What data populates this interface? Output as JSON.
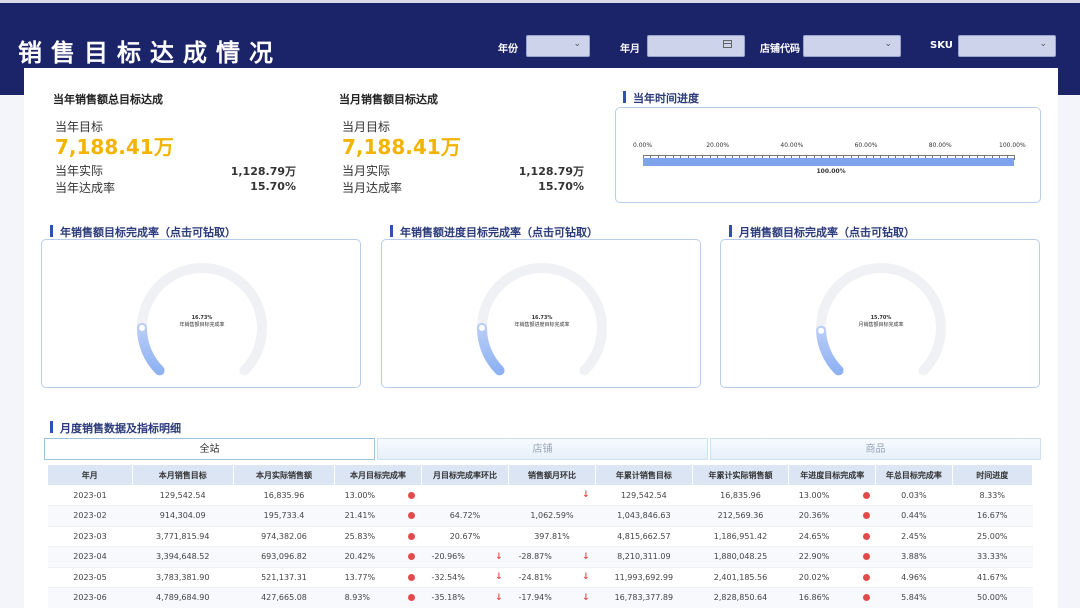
{
  "header": {
    "title": "销售目标达成情况",
    "filters": [
      {
        "label": "年份",
        "type": "select"
      },
      {
        "label": "年月",
        "type": "date"
      },
      {
        "label": "店铺代码",
        "type": "select"
      },
      {
        "label": "SKU",
        "type": "select"
      }
    ]
  },
  "kpi_year": {
    "title": "当年销售额总目标达成",
    "target_label": "当年目标",
    "target_value": "7,188.41万",
    "actual_label": "当年实际",
    "actual_value": "1,128.79万",
    "rate_label": "当年达成率",
    "rate_value": "15.70%"
  },
  "kpi_month": {
    "title": "当月销售额目标达成",
    "target_label": "当月目标",
    "target_value": "7,188.41万",
    "actual_label": "当月实际",
    "actual_value": "1,128.79万",
    "rate_label": "当月达成率",
    "rate_value": "15.70%"
  },
  "time_progress": {
    "title": "当年时间进度",
    "ticks": [
      "0.00%",
      "20.00%",
      "40.00%",
      "60.00%",
      "80.00%",
      "100.00%"
    ],
    "value": 1.0,
    "value_label": "100.00%"
  },
  "gauges": [
    {
      "title": "年销售额目标完成率（点击可钻取）",
      "value_label": "16.73%",
      "caption": "年销售额目标完成率",
      "value": 0.1673
    },
    {
      "title": "年销售额进度目标完成率（点击可钻取）",
      "value_label": "16.73%",
      "caption": "年销售额进度目标完成率",
      "value": 0.1673
    },
    {
      "title": "月销售额目标完成率（点击可钻取）",
      "value_label": "15.70%",
      "caption": "月销售额目标完成率",
      "value": 0.157
    }
  ],
  "detail": {
    "title": "月度销售数据及指标明细",
    "tabs": [
      "全站",
      "店铺",
      "商品"
    ],
    "columns": [
      "年月",
      "本月销售目标",
      "本月实际销售额",
      "本月目标完成率",
      "月目标完成率环比",
      "销售额月环比",
      "年累计销售目标",
      "年累计实际销售额",
      "年进度目标完成率",
      "年总目标完成率",
      "时间进度"
    ],
    "rows": [
      [
        "2023-01",
        "129,542.54",
        "16,835.96",
        "13.00%",
        "",
        "",
        "129,542.54",
        "16,835.96",
        "13.00%",
        "0.03%",
        "8.33%"
      ],
      [
        "2023-02",
        "914,304.09",
        "195,733.4",
        "21.41%",
        "64.72%",
        "1,062.59%",
        "1,043,846.63",
        "212,569.36",
        "20.36%",
        "0.44%",
        "16.67%"
      ],
      [
        "2023-03",
        "3,771,815.94",
        "974,382.06",
        "25.83%",
        "20.67%",
        "397.81%",
        "4,815,662.57",
        "1,186,951.42",
        "24.65%",
        "2.45%",
        "25.00%"
      ],
      [
        "2023-04",
        "3,394,648.52",
        "693,096.82",
        "20.42%",
        "-20.96%",
        "-28.87%",
        "8,210,311.09",
        "1,880,048.25",
        "22.90%",
        "3.88%",
        "33.33%"
      ],
      [
        "2023-05",
        "3,783,381.90",
        "521,137.31",
        "13.77%",
        "-32.54%",
        "-24.81%",
        "11,993,692.99",
        "2,401,185.56",
        "20.02%",
        "4.96%",
        "41.67%"
      ],
      [
        "2023-06",
        "4,789,684.90",
        "427,665.08",
        "8.93%",
        "-35.18%",
        "-17.94%",
        "16,783,377.89",
        "2,828,850.64",
        "16.86%",
        "5.84%",
        "50.00%"
      ]
    ],
    "row_flags": [
      {
        "c3": true,
        "c4": false,
        "c5": true,
        "c8": true
      },
      {
        "c3": true,
        "c4": false,
        "c5": false,
        "c8": true
      },
      {
        "c3": true,
        "c4": false,
        "c5": false,
        "c8": true
      },
      {
        "c3": true,
        "c4": true,
        "c5": true,
        "c8": true
      },
      {
        "c3": true,
        "c4": true,
        "c5": true,
        "c8": true
      },
      {
        "c3": true,
        "c4": true,
        "c5": true,
        "c8": true
      }
    ]
  }
}
